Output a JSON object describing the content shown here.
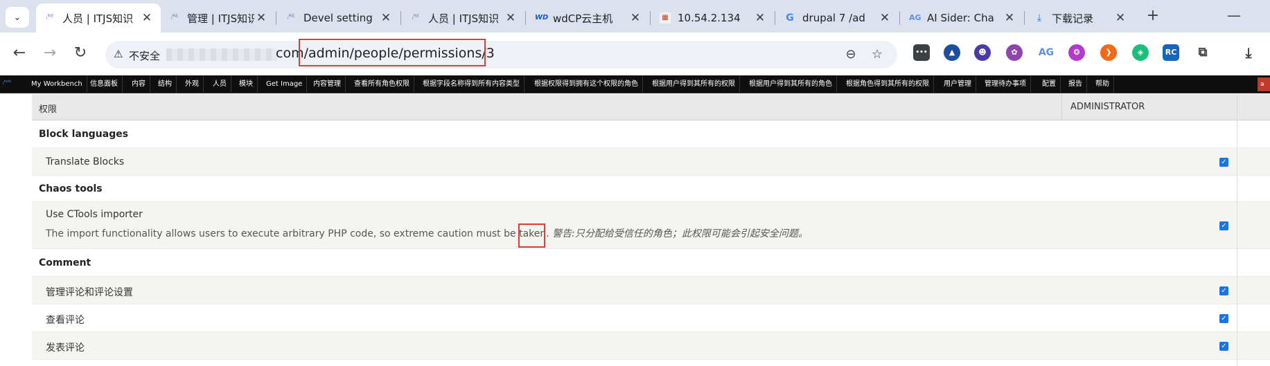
{
  "browser": {
    "tabs": [
      {
        "favicon": "itjs-logo-icon",
        "title": "人员 | ITJS知识",
        "active": true
      },
      {
        "favicon": "itjs-logo-icon",
        "title": "管理 | ITJS知识",
        "active": false
      },
      {
        "favicon": "itjs-logo-icon",
        "title": "Devel setting",
        "active": false
      },
      {
        "favicon": "itjs-logo-icon",
        "title": "人员 | ITJS知识",
        "active": false
      },
      {
        "favicon": "wdcp-logo-icon",
        "title": "wdCP云主机",
        "active": false
      },
      {
        "favicon": "phpmyadmin-logo-icon",
        "title": "10.54.2.134",
        "active": false
      },
      {
        "favicon": "google-logo-icon",
        "title": "drupal 7 /ad",
        "active": false
      },
      {
        "favicon": "aisider-logo-icon",
        "title": "AI Sider: Cha",
        "active": false
      },
      {
        "favicon": "download-icon",
        "title": "下载记录",
        "active": false
      }
    ],
    "tab_menu_glyph": "⌄",
    "newtab_glyph": "+",
    "minimize_glyph": "—",
    "back_glyph": "←",
    "forward_glyph": "→",
    "reload_glyph": "↻",
    "omnibox": {
      "warning_glyph": "⚠",
      "insecure_label": "不安全",
      "url_visible": "com/admin/people/permissions/3",
      "zoom_glyph": "⊖",
      "star_glyph": "☆"
    },
    "extensions": [
      {
        "name": "ext-dots-icon",
        "glyph": "•••",
        "color": "#3c4043"
      },
      {
        "name": "ext-triangle-icon",
        "glyph": "▲",
        "color": "#1f4e9c"
      },
      {
        "name": "ext-face-icon",
        "glyph": "☻",
        "color": "#4a3aa8"
      },
      {
        "name": "ext-gear-icon",
        "glyph": "✿",
        "color": "#8e44ad"
      },
      {
        "name": "ext-ag-icon",
        "glyph": "AG",
        "color": "#5b8def"
      },
      {
        "name": "ext-brain-icon",
        "glyph": "❂",
        "color": "#b03cc8"
      },
      {
        "name": "ext-orange-icon",
        "glyph": "❯",
        "color": "#f06a1b"
      },
      {
        "name": "ext-leaf-icon",
        "glyph": "◈",
        "color": "#1bbf7a"
      },
      {
        "name": "ext-rc-icon",
        "glyph": "RC",
        "color": "#1565c0"
      },
      {
        "name": "ext-puzzle-icon",
        "glyph": "⧉",
        "color": "#3c4043"
      },
      {
        "name": "ext-download-icon",
        "glyph": "⤓",
        "color": "#3c4043"
      }
    ]
  },
  "admin_menu": {
    "logo_text": "ᵢʳᵉⁱᶜ",
    "items": [
      "My Workbench",
      "信息面板",
      "内容",
      "结构",
      "外观",
      "人员",
      "模块",
      "Get Image",
      "内容管理",
      "查看所有角色权限",
      "根据字段名称得到所有内容类型",
      "根据权限得到拥有这个权限的角色",
      "根据用户得到其所有的权限",
      "根据用户得到其所有的角色",
      "根据角色得到其所有的权限",
      "用户管理",
      "管理待办事项",
      "配置",
      "报告",
      "帮助"
    ],
    "corner_badge": "a"
  },
  "permissions": {
    "header_permission": "权限",
    "header_role": "ADMINISTRATOR",
    "check_glyph": "✓",
    "modules": [
      {
        "title": "Block languages",
        "perms": [
          {
            "name": "Translate Blocks",
            "description": "",
            "warning": "",
            "checked": true
          }
        ]
      },
      {
        "title": "Chaos tools",
        "perms": [
          {
            "name": "Use CTools importer",
            "description": "The import functionality allows users to execute arbitrary PHP code, so extreme caution must be taken.",
            "warning_label": "警告:",
            "warning": "只分配给受信任的角色；此权限可能会引起安全问题。",
            "checked": true
          }
        ]
      },
      {
        "title": "Comment",
        "perms": [
          {
            "name": "管理评论和评论设置",
            "description": "",
            "warning": "",
            "checked": true
          },
          {
            "name": "查看评论",
            "description": "",
            "warning": "",
            "checked": true
          },
          {
            "name": "发表评论",
            "description": "",
            "warning": "",
            "checked": true
          }
        ]
      }
    ]
  }
}
